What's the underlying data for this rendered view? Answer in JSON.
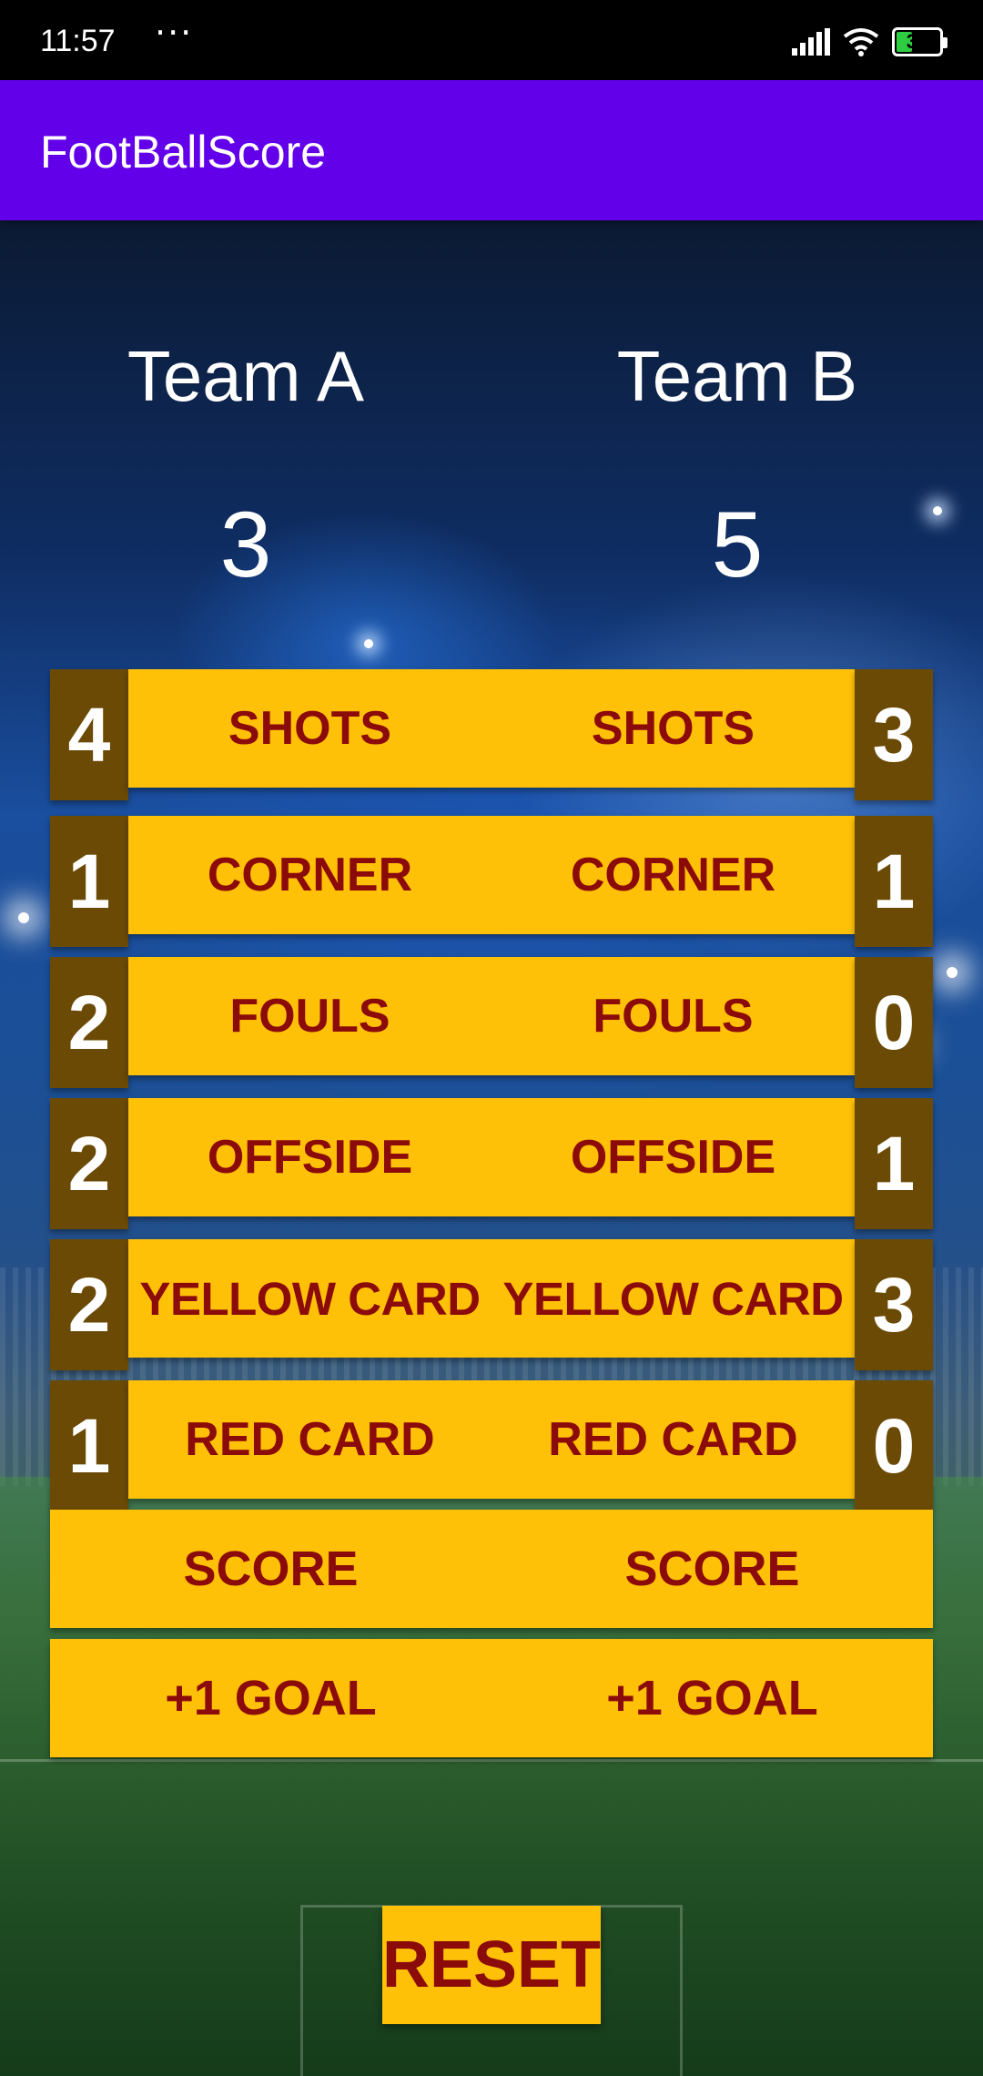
{
  "status_bar": {
    "time": "11:57",
    "dots": "···",
    "battery": "38",
    "battery_level": 0.38,
    "icons": [
      "signal-icon",
      "wifi-icon",
      "battery-icon"
    ]
  },
  "app_bar": {
    "title": "FootBallScore"
  },
  "team_a": {
    "name": "Team A",
    "score": "3"
  },
  "team_b": {
    "name": "Team B",
    "score": "5"
  },
  "stats": [
    {
      "label_a": "SHOTS",
      "label_b": "SHOTS",
      "count_a": "4",
      "count_b": "3"
    },
    {
      "label_a": "CORNER",
      "label_b": "CORNER",
      "count_a": "1",
      "count_b": "1"
    },
    {
      "label_a": "FOULS",
      "label_b": "FOULS",
      "count_a": "2",
      "count_b": "0"
    },
    {
      "label_a": "OFFSIDE",
      "label_b": "OFFSIDE",
      "count_a": "2",
      "count_b": "1"
    },
    {
      "label_a": "YELLOW CARD",
      "label_b": "YELLOW CARD",
      "count_a": "2",
      "count_b": "3"
    },
    {
      "label_a": "RED CARD",
      "label_b": "RED CARD",
      "count_a": "1",
      "count_b": "0"
    }
  ],
  "score_row": {
    "label_a": "SCORE",
    "label_b": "SCORE"
  },
  "goal_row": {
    "label_a": "+1 GOAL",
    "label_b": "+1 GOAL"
  },
  "reset": {
    "label": "RESET"
  },
  "colors": {
    "app_bar": "#6200ea",
    "button_bg": "#ffc107",
    "button_text": "#8b0a0a",
    "count_box": "#6b4a06"
  }
}
